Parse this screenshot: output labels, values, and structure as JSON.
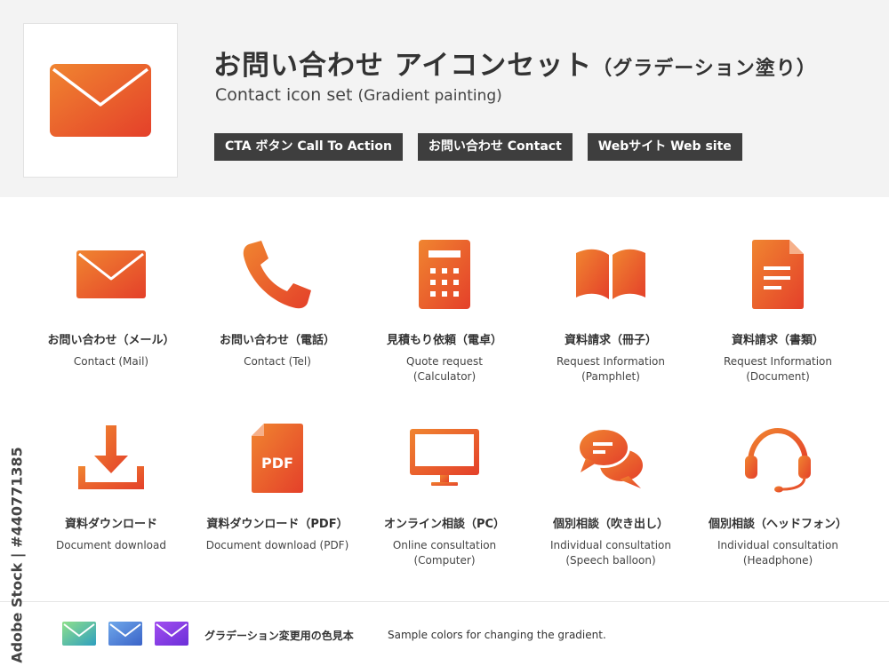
{
  "header": {
    "title_ja": "お問い合わせ アイコンセット",
    "title_ja_sub": "（グラデーション塗り）",
    "title_en": "Contact icon set",
    "title_en_sub": "(Gradient painting)",
    "tags": [
      "CTA ボタン Call To Action",
      "お問い合わせ Contact",
      "Webサイト Web site"
    ],
    "hero_icon": "mail-icon"
  },
  "icons": [
    {
      "icon": "mail-icon",
      "ja": "お問い合わせ（メール）",
      "en": "Contact (Mail)"
    },
    {
      "icon": "phone-icon",
      "ja": "お問い合わせ（電話）",
      "en": "Contact (Tel)"
    },
    {
      "icon": "calculator-icon",
      "ja": "見積もり依頼（電卓）",
      "en": "Quote request\n(Calculator)"
    },
    {
      "icon": "pamphlet-icon",
      "ja": "資料請求（冊子）",
      "en": "Request Information\n(Pamphlet)"
    },
    {
      "icon": "document-icon",
      "ja": "資料請求（書類）",
      "en": "Request Information\n(Document)"
    },
    {
      "icon": "download-icon",
      "ja": "資料ダウンロード",
      "en": "Document download"
    },
    {
      "icon": "pdf-icon",
      "ja": "資料ダウンロード（PDF）",
      "en": "Document download (PDF)",
      "pdf_text": "PDF"
    },
    {
      "icon": "monitor-icon",
      "ja": "オンライン相談（PC）",
      "en": "Online consultation\n(Computer)"
    },
    {
      "icon": "speech-balloon-icon",
      "ja": "個別相談（吹き出し）",
      "en": "Individual consultation\n(Speech balloon)"
    },
    {
      "icon": "headphone-icon",
      "ja": "個別相談（ヘッドフォン）",
      "en": "Individual consultation\n(Headphone)"
    }
  ],
  "footer": {
    "sample_ja": "グラデーション変更用の色見本",
    "sample_en": "Sample colors for changing the gradient.",
    "swatches": [
      {
        "icon": "mail-icon",
        "from": "#8fe08a",
        "to": "#2f9fbf"
      },
      {
        "icon": "mail-icon",
        "from": "#6fa8ea",
        "to": "#3a63c8"
      },
      {
        "icon": "mail-icon",
        "from": "#a24ef0",
        "to": "#6b2fd8"
      }
    ]
  },
  "watermark": "Adobe Stock | #440771385",
  "colors": {
    "gradient_from": "#f08530",
    "gradient_to": "#e4402a",
    "header_bg": "#f3f3f3",
    "tag_bg": "#3e3e3e"
  }
}
